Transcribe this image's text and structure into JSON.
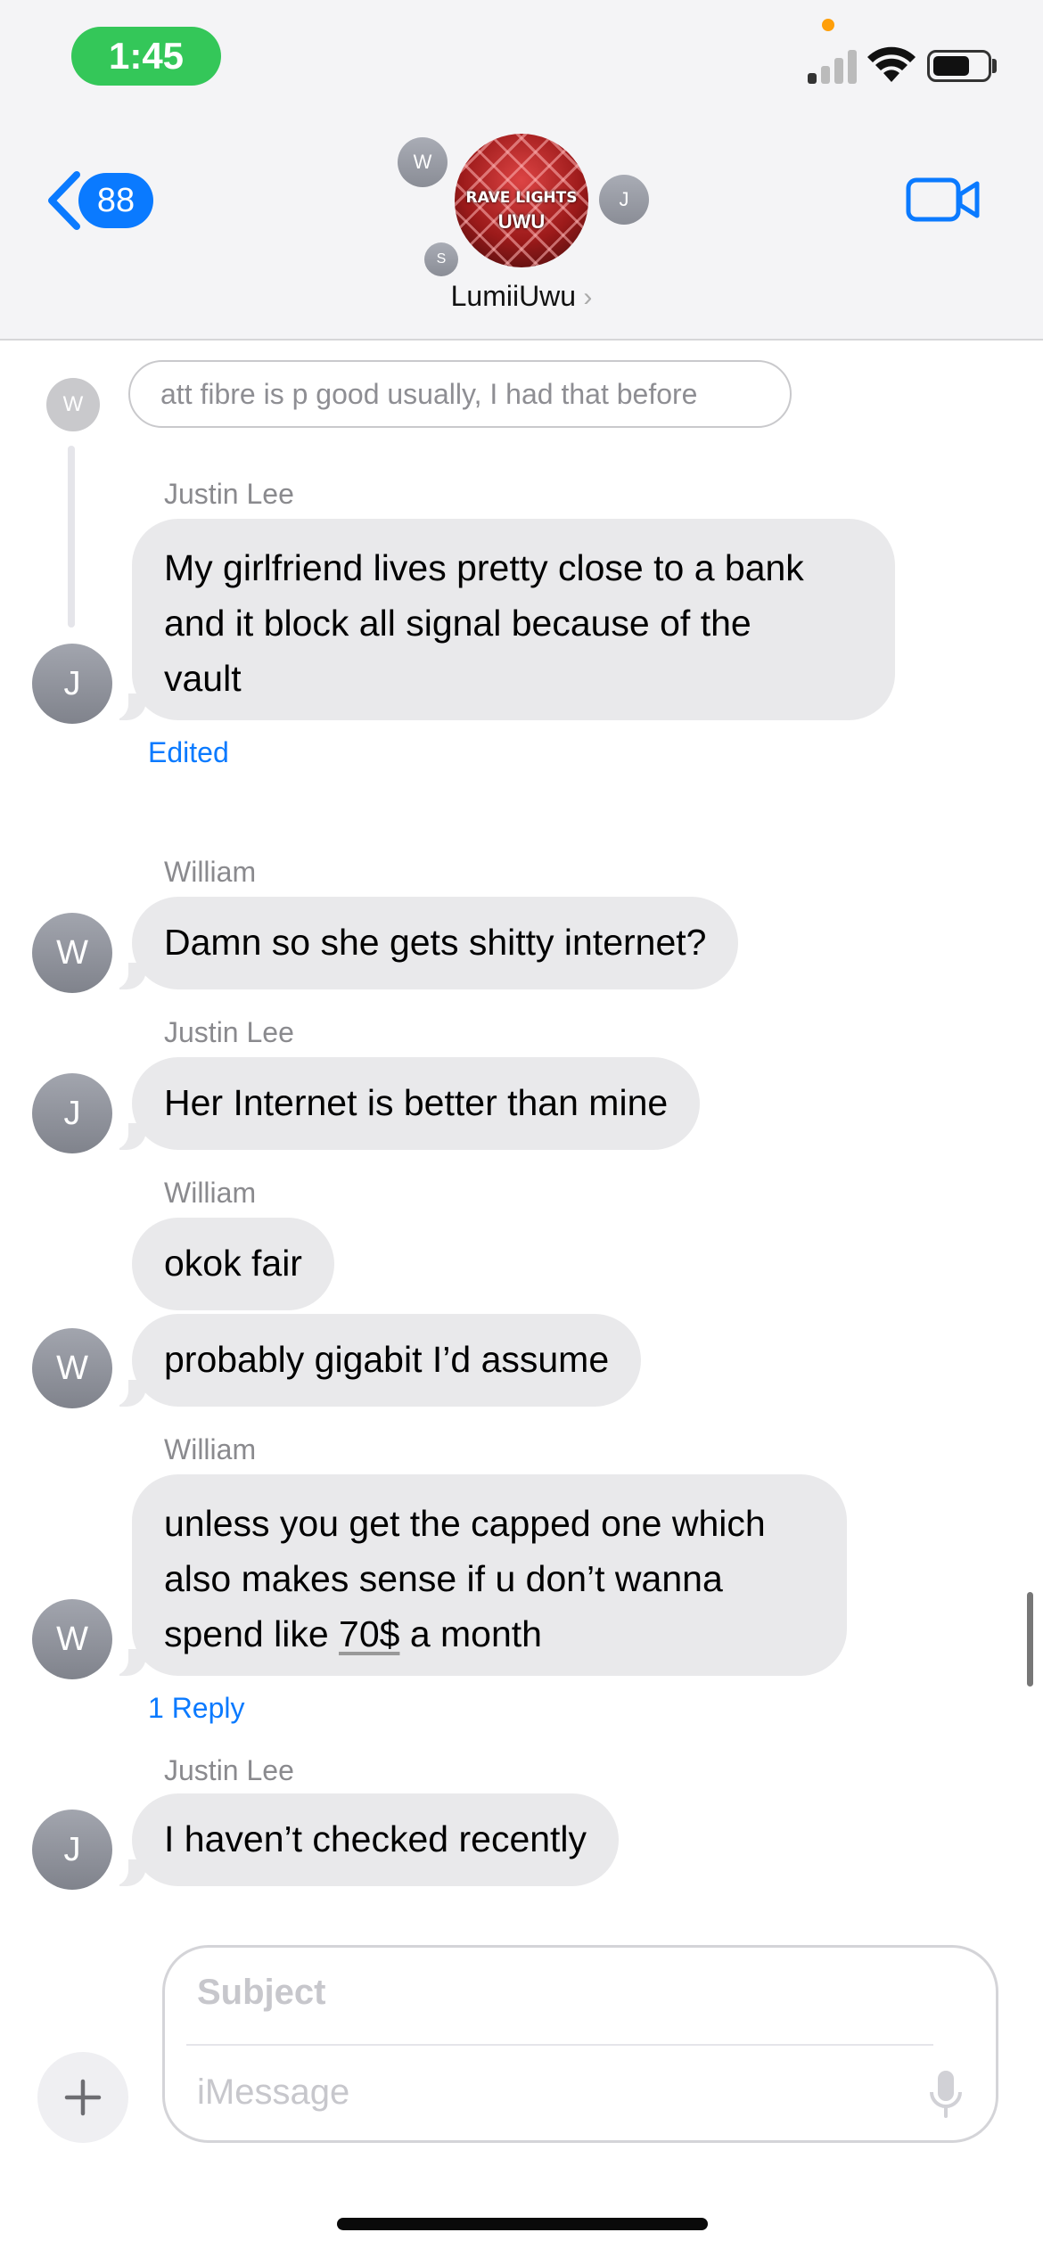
{
  "status_bar": {
    "time": "1:45"
  },
  "nav": {
    "back_count": "88",
    "group_name": "LumiiUwu",
    "group_photo_text_1": "RAVE LIGHTS",
    "group_photo_text_2": "UWU",
    "member_initials": [
      "W",
      "J",
      "S"
    ]
  },
  "messages": {
    "reply_preview": {
      "initial": "W",
      "text": "att fibre is p good usually, I had that before"
    },
    "m1": {
      "sender": "Justin Lee",
      "initial": "J",
      "lines": [
        "My girlfriend lives pretty close to a bank",
        "and it block all signal because of the",
        "vault"
      ],
      "status": "Edited"
    },
    "m2": {
      "sender": "William",
      "initial": "W",
      "text": "Damn so she gets shitty internet?"
    },
    "m3": {
      "sender": "Justin Lee",
      "initial": "J",
      "text": "Her Internet is better than mine"
    },
    "m4": {
      "sender": "William",
      "initial": "W",
      "text_a": "okok fair",
      "text_b": "probably gigabit I’d assume"
    },
    "m5": {
      "sender": "William",
      "initial": "W",
      "line1": "unless you get the capped one which",
      "line2": "also makes sense if u don’t wanna",
      "line3_pre": "spend like ",
      "line3_link": "70$",
      "line3_post": " a month",
      "status": "1 Reply"
    },
    "m6": {
      "sender": "Justin Lee",
      "initial": "J",
      "text": "I haven’t checked recently"
    }
  },
  "composer": {
    "subject_placeholder": "Subject",
    "message_placeholder": "iMessage"
  },
  "colors": {
    "accent": "#0a7aff",
    "bubble": "#e9e9eb",
    "status_green": "#34c759"
  }
}
